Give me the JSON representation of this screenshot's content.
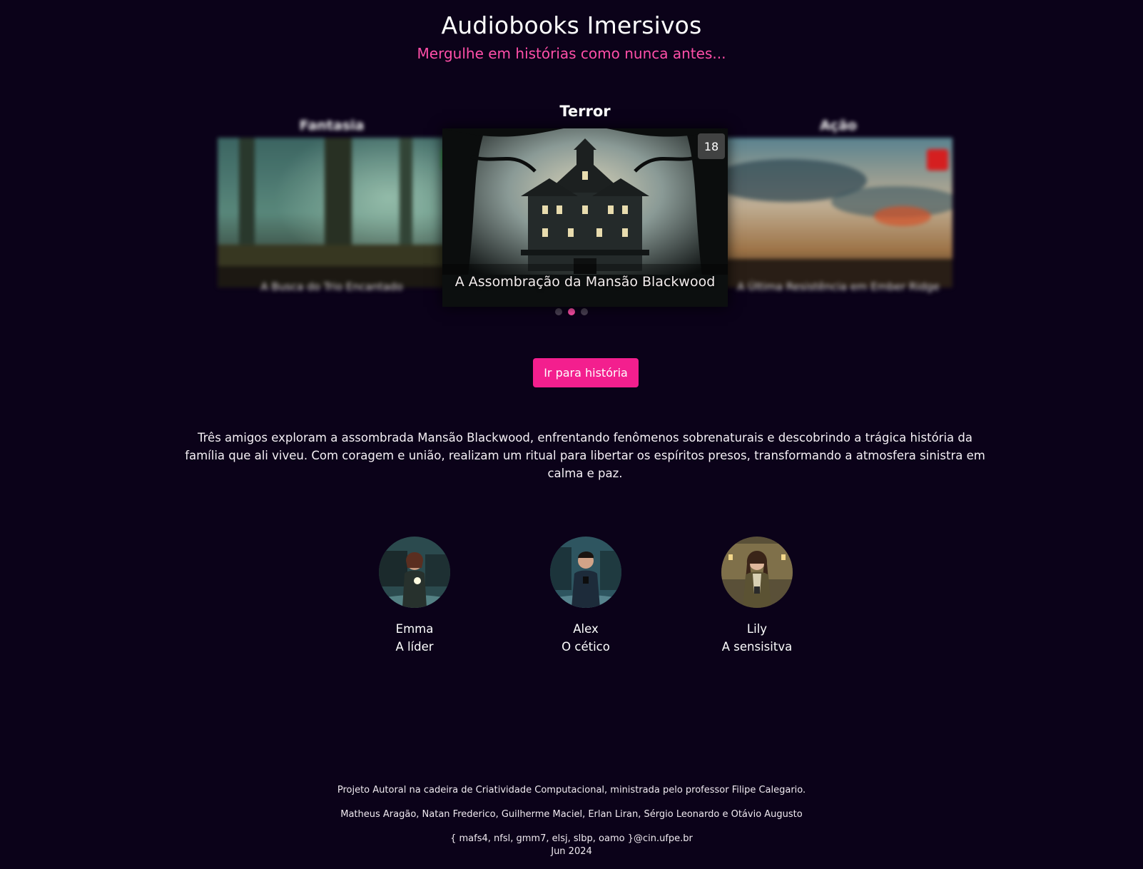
{
  "header": {
    "title": "Audiobooks Imersivos",
    "subtitle": "Mergulhe em histórias como nunca antes..."
  },
  "carousel": {
    "active_index": 1,
    "slides": [
      {
        "genre": "Fantasia",
        "title": "A Busca do Trio Encantado",
        "badge": "",
        "badge_color": "#2fae3e"
      },
      {
        "genre": "Terror",
        "title": "A Assombração da Mansão Blackwood",
        "badge": "18",
        "badge_color": "#464646"
      },
      {
        "genre": "Ação",
        "title": "A Última Resistência em Ember Ridge",
        "badge": "",
        "badge_color": "#e02121"
      }
    ]
  },
  "cta": {
    "label": "Ir para história"
  },
  "story": {
    "description": "Três amigos exploram a assombrada Mansão Blackwood, enfrentando fenômenos sobrenaturais e descobrindo a trágica história da família que ali viveu. Com coragem e união, realizam um ritual para libertar os espíritos presos, transformando a atmosfera sinistra em calma e paz."
  },
  "characters": [
    {
      "name": "Emma",
      "role": "A líder"
    },
    {
      "name": "Alex",
      "role": "O cético"
    },
    {
      "name": "Lily",
      "role": "A sensisitva"
    }
  ],
  "footer": {
    "line1": "Projeto Autoral na cadeira de Criatividade Computacional, ministrada pelo professor Filipe Calegario.",
    "line2": "Matheus Aragão, Natan Frederico, Guilherme Maciel, Erlan Liran, Sérgio Leonardo e Otávio Augusto",
    "line3": "{ mafs4, nfsl, gmm7, elsj, slbp, oamo }@cin.ufpe.br",
    "line4": "Jun 2024"
  },
  "colors": {
    "background": "#0b0219",
    "accent": "#ff4fa8",
    "button": "#f31f8e"
  }
}
